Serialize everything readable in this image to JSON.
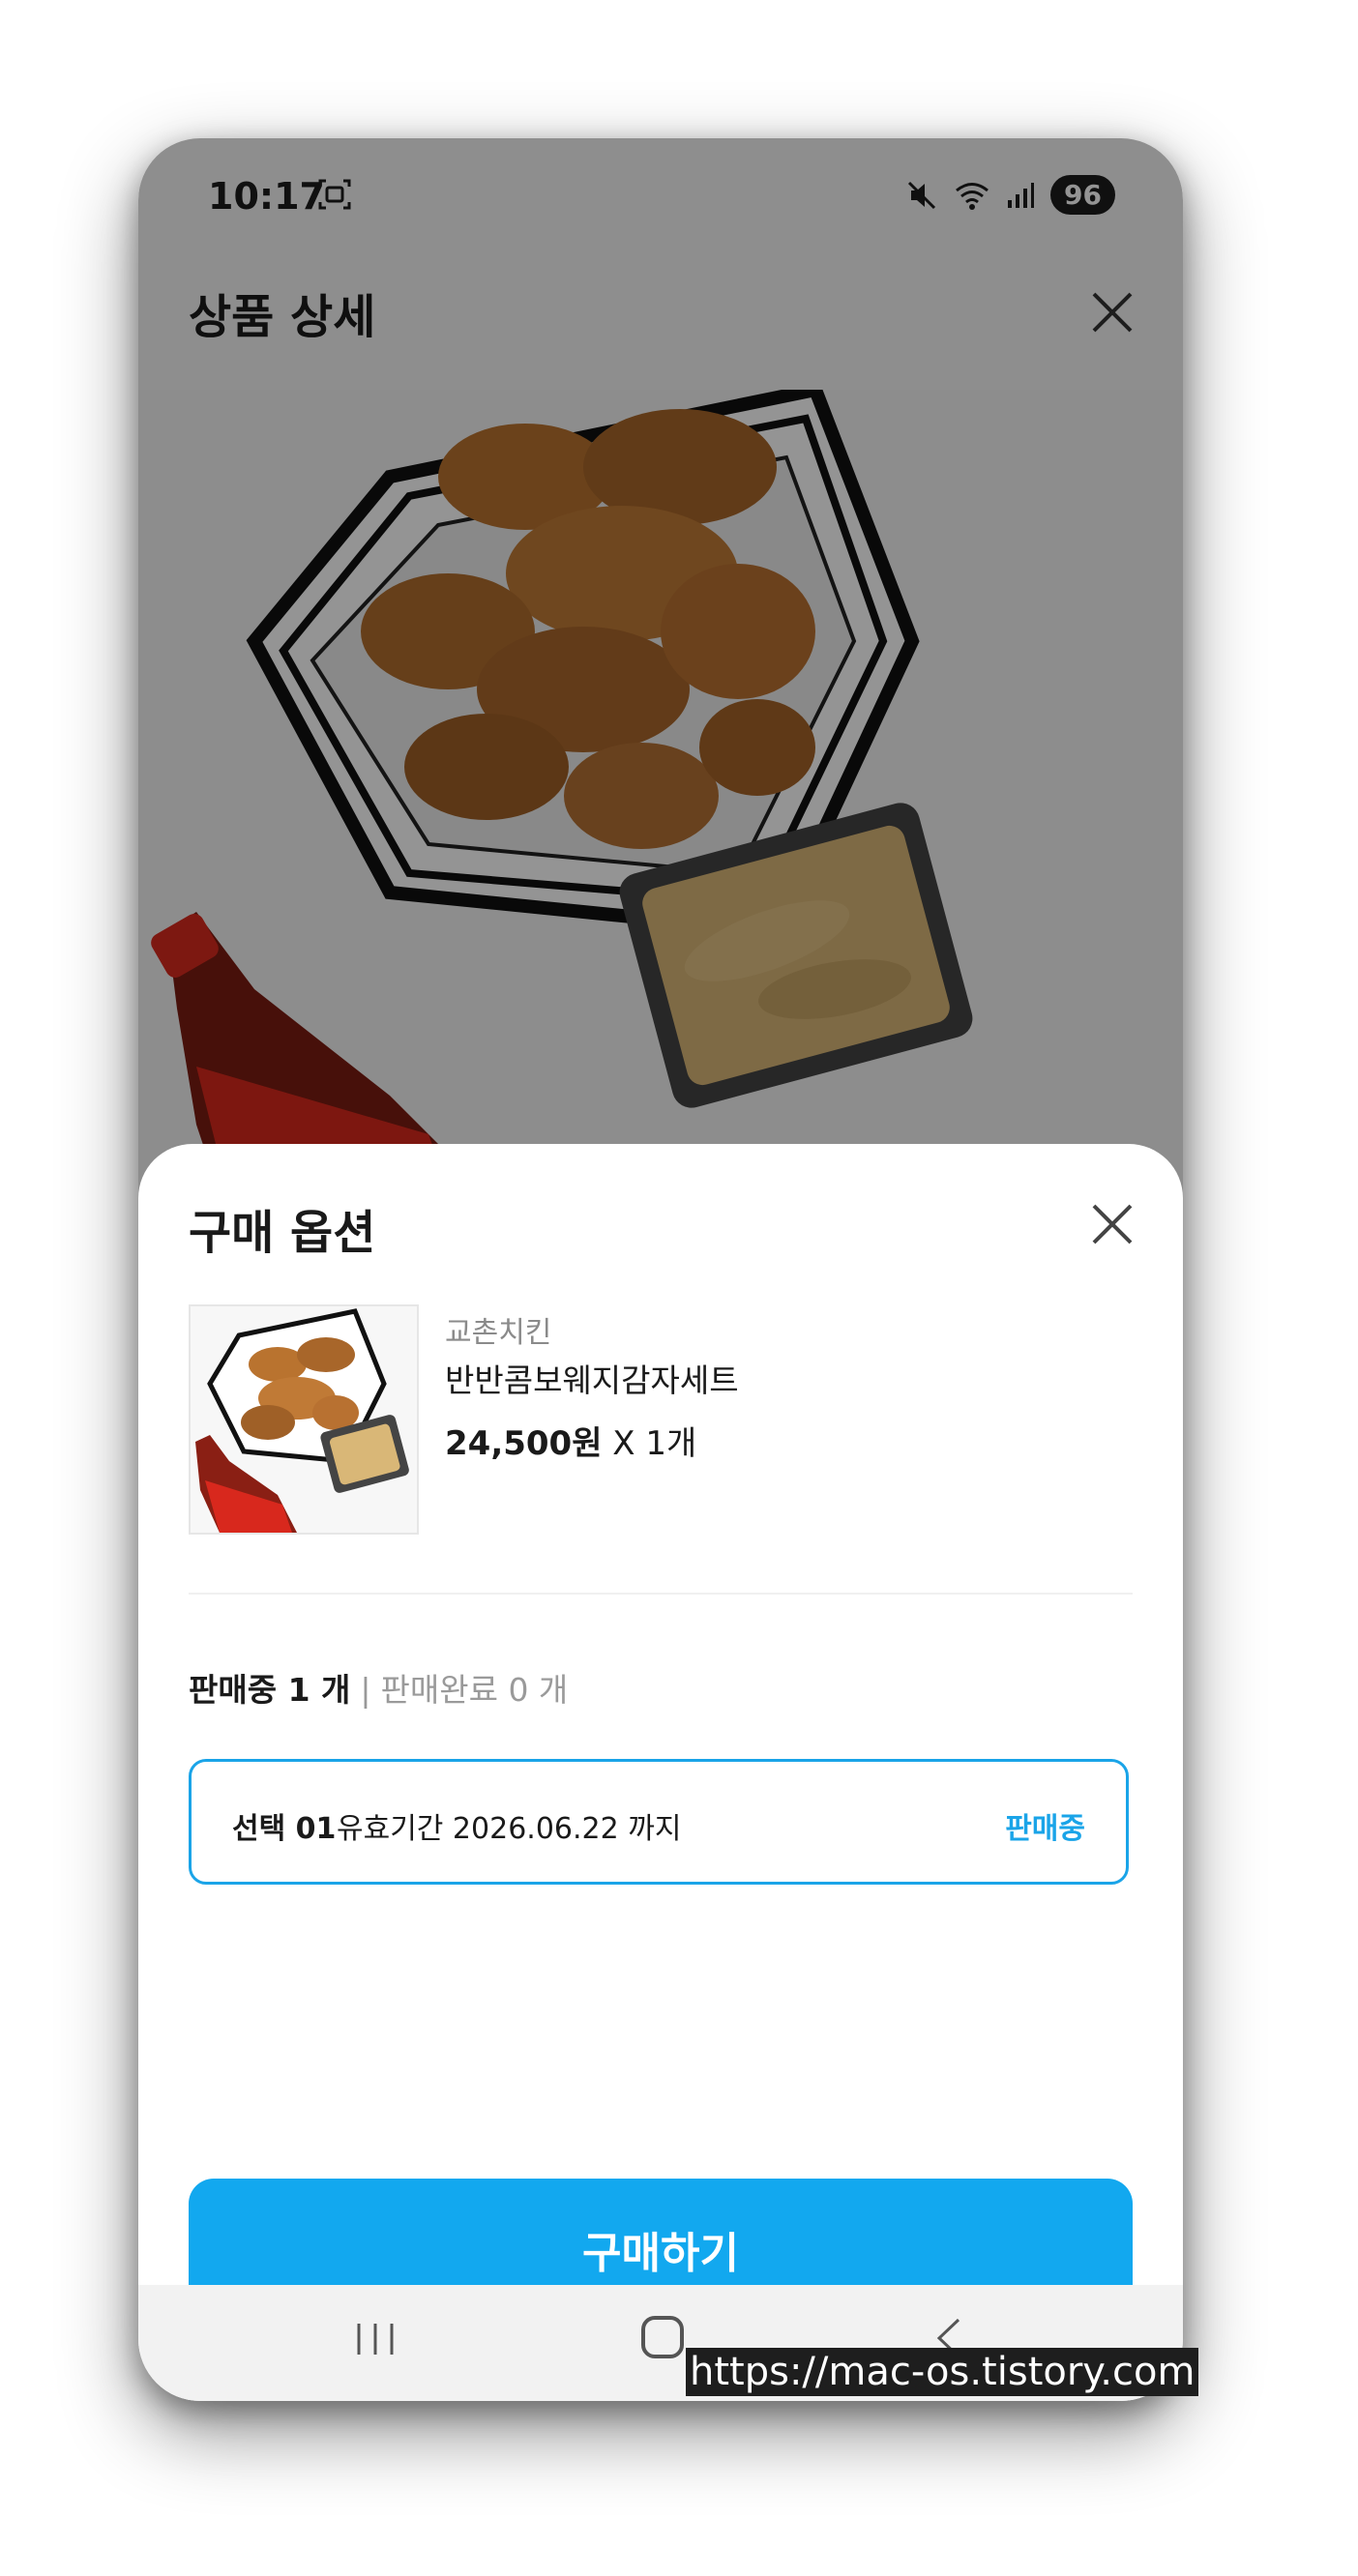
{
  "status_bar": {
    "time": "10:17",
    "battery": "96"
  },
  "background_page": {
    "title": "상품 상세"
  },
  "sheet": {
    "title": "구매 옵션",
    "brand": "교촌치킨",
    "product_name": "반반콤보웨지감자세트",
    "price": "24,500원",
    "quantity": "X 1개",
    "stock_on_sale": "판매중 1 개",
    "stock_separator": "|",
    "stock_sold_out": "판매완료 0 개",
    "option": {
      "label": "선택 01",
      "description": "유효기간 2026.06.22 까지",
      "status": "판매중"
    },
    "buy_button": "구매하기"
  },
  "watermark": "https://mac-os.tistory.com",
  "colors": {
    "accent": "#12a8ef",
    "option_border": "#1aa4e8"
  },
  "icons": [
    "screenshot-icon",
    "mute-icon",
    "wifi-icon",
    "signal-icon",
    "close-icon",
    "recent-apps-icon",
    "home-icon",
    "back-icon"
  ]
}
